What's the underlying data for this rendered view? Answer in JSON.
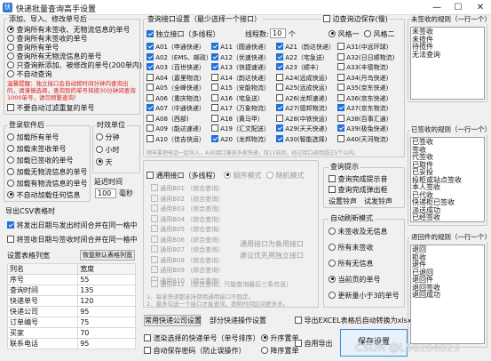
{
  "window": {
    "title": "快递批量查询高手设置",
    "minimize": "—",
    "maximize": "☐",
    "close": "✕"
  },
  "add_import": {
    "title": "添加、导入、修改单号后",
    "options": [
      {
        "label": "查询所有未签收、无物流信息的单号",
        "checked": true
      },
      {
        "label": "查询所有未签收的单号",
        "checked": false
      },
      {
        "label": "查询所有单号",
        "checked": false
      },
      {
        "label": "查询所有无物流信息的单号",
        "checked": false
      },
      {
        "label": "只查询新添加、被修改的单号(200单内)",
        "checked": false
      },
      {
        "label": "不自动查询",
        "checked": false
      }
    ],
    "warning": "温馨提醒：独立接口会自动按时间分钟内查询出的，请谨慎选择，查询到的单号将按30分钟间查询1000单号，请勿频繁查询！",
    "auto_filter": "不要自动过滤重复的单号"
  },
  "login": {
    "title": "登录软件后",
    "options": [
      {
        "label": "加载所有单号",
        "checked": false
      },
      {
        "label": "加载未签收单号",
        "checked": false
      },
      {
        "label": "加载已签收的单号",
        "checked": false
      },
      {
        "label": "加载无物流信息的单号",
        "checked": false
      },
      {
        "label": "加载有物流信息的单号",
        "checked": false
      },
      {
        "label": "不自动加载任何信息",
        "checked": true
      }
    ]
  },
  "time_unit": {
    "title": "时效单位",
    "options": [
      {
        "label": "分钟",
        "checked": false
      },
      {
        "label": "小时",
        "checked": false
      },
      {
        "label": "天",
        "checked": true
      }
    ]
  },
  "delay": {
    "title": "延迟时间",
    "value": "100",
    "unit": "毫秒"
  },
  "csv": {
    "title": "导出CSV表格时",
    "options": [
      {
        "label": "将发出日期与发出时间合并在同一格中",
        "checked": true
      },
      {
        "label": "将签收日期与签收时间合并在同一格中",
        "checked": false
      }
    ]
  },
  "columns": {
    "title": "设置表格列宽",
    "restore_button": "恢复默认表格列宽",
    "header": [
      "列名",
      "宽度"
    ],
    "rows": [
      {
        "name": "序号",
        "width": "55"
      },
      {
        "name": "查询时间",
        "width": "135"
      },
      {
        "name": "快递单号",
        "width": "120"
      },
      {
        "name": "快递公司",
        "width": "95"
      },
      {
        "name": "订单编号",
        "width": "75"
      },
      {
        "name": "买家",
        "width": "70"
      },
      {
        "name": "联系电话",
        "width": "95"
      }
    ]
  },
  "api": {
    "title": "查询接口设置（最少选择一个接口）",
    "edge_label": "边查询边保存(慢)",
    "standalone_label": "独立接口（多线程）",
    "thread_label": "线程数:",
    "thread_value": "10",
    "thread_unit": "个",
    "style1": "风格一",
    "style2": "风格二",
    "interfaces": [
      {
        "label": "A01（申通快递）",
        "checked": true
      },
      {
        "label": "A11（圆通快递）",
        "checked": true
      },
      {
        "label": "A21（韵达快递）",
        "checked": true
      },
      {
        "label": "A31(中远环球)",
        "checked": false
      },
      {
        "label": "A02（EMS、邮政）",
        "checked": true
      },
      {
        "label": "A12（优速快递）",
        "checked": true
      },
      {
        "label": "A22（宅急送）",
        "checked": true
      },
      {
        "label": "A32(日日顺物流)",
        "checked": false
      },
      {
        "label": "A03（百世快递）",
        "checked": true
      },
      {
        "label": "A13（快捷速递）",
        "checked": true
      },
      {
        "label": "A23（顺丰）",
        "checked": true
      },
      {
        "label": "A33(丰德物流)",
        "checked": false
      },
      {
        "label": "A04（嘉里物流）",
        "checked": false
      },
      {
        "label": "A14（韵达快递）",
        "checked": false
      },
      {
        "label": "A24(远成快运)",
        "checked": false
      },
      {
        "label": "A34(丹鸟快递)",
        "checked": false
      },
      {
        "label": "A05（全峰快递）",
        "checked": false
      },
      {
        "label": "A15（安能物流）",
        "checked": false
      },
      {
        "label": "A25(远成快运)",
        "checked": false
      },
      {
        "label": "A35(京东快递)",
        "checked": false
      },
      {
        "label": "A06（重庆物流）",
        "checked": false
      },
      {
        "label": "A16（宅急送）",
        "checked": false
      },
      {
        "label": "A26(龙邦速递)",
        "checked": false
      },
      {
        "label": "A36(京东快递)",
        "checked": false
      },
      {
        "label": "A07（中通快递）",
        "checked": true
      },
      {
        "label": "A17（万象物流）",
        "checked": false
      },
      {
        "label": "A27(德邦物流)",
        "checked": true
      },
      {
        "label": "A37(京东物流)",
        "checked": true
      },
      {
        "label": "A08（西部)",
        "checked": false
      },
      {
        "label": "A18（黄马甲）",
        "checked": false
      },
      {
        "label": "A28(中铁快运)",
        "checked": false
      },
      {
        "label": "A38(百事汇通)",
        "checked": false
      },
      {
        "label": "A09（能达速递）",
        "checked": false
      },
      {
        "label": "A19（汇文配送）",
        "checked": false
      },
      {
        "label": "A29(天天快递)",
        "checked": true
      },
      {
        "label": "A39(极兔快递)",
        "checked": true
      },
      {
        "label": "A10（佳吉快运）",
        "checked": false
      },
      {
        "label": "A20（龙邦物流）",
        "checked": true
      },
      {
        "label": "A30(智能选择)",
        "checked": true
      },
      {
        "label": "A40(天河物流)",
        "checked": false
      }
    ],
    "hint": "顺丰要把电话一起导入，A30接口兼容多家快递，双11前后，经过接口调用超过5个以内。",
    "common_label": "通用接口（多线程）",
    "seq_mode": "顺序模式",
    "rand_mode": "随机模式",
    "common_items": [
      "通用B01 （综合查询）",
      "通用B02 （综合查询）",
      "通用B03 （综合查询）",
      "通用B04 （综合查询）",
      "通用B05 （综合查询）",
      "通用B06 （综合查询）",
      "通用B07 （综合查询）",
      "通用B08 （综合查询）",
      "通用B09 （综合查询）",
      "通用B10 （综合查询）"
    ],
    "common_last": "通用B11 （综合查询，只能查询最后三条信息）",
    "common_note1": "通用接口为备用接口",
    "common_note2": "建议优先用独立接口",
    "footer_note1": "1、每家快递都支持使用通用接口不固定。",
    "footer_note2": "2、最多勾选一个接口才能查询，按照时间区间更多多。"
  },
  "query_hint": {
    "title": "查询提示",
    "options": [
      {
        "label": "查询完成提示音",
        "checked": false
      },
      {
        "label": "查询完成弹出框",
        "checked": false
      }
    ],
    "set_sound": "设置铃声",
    "test_sound": "试发铃声"
  },
  "auto_refresh": {
    "title": "自动刷新模式",
    "options": [
      {
        "label": "未签收及无信息",
        "checked": false
      },
      {
        "label": "所有未签收",
        "checked": false
      },
      {
        "label": "所有无信息",
        "checked": false
      },
      {
        "label": "当前页的单号",
        "checked": true
      },
      {
        "label": "更新量小于3的单号",
        "checked": false
      }
    ]
  },
  "bottom": {
    "common_settings_button": "常用快递公司设置",
    "partial_settings_button": "部分快递操作设置",
    "export_excel": "导出EXCEL表格后自动转换为xlsx格式",
    "color_label": "渲染选择的快递单号（单号排序）",
    "asc": "升序置单",
    "desc": "降序置单",
    "auto_save": "自动保存密码（防止误操作）",
    "auto_sync": "自用导出",
    "save_button": "保存设置",
    "watermark": "CSDN @L50204023"
  },
  "unsigned_rules": {
    "title": "未签收的规则（一行一个）",
    "lines": [
      "未签收",
      "未揽件",
      "待揽件",
      "无法查询"
    ]
  },
  "signed_rules": {
    "title": "已签收的规则（一行一个）",
    "lines": [
      "已签收",
      "签收",
      "代签收",
      "已取件",
      "已妥投",
      "投柜或站点签收",
      "本人签收",
      "已代收",
      "快递柜已签收",
      "派送成功",
      "已经签收",
      "门卫签收",
      "驿站代收",
      "家人代签",
      "已签收人",
      "本人已签"
    ]
  },
  "return_rules": {
    "title": "退回件的规则（一行一个）",
    "lines": [
      "退回",
      "拒收",
      "退件",
      "已退回",
      "退回件",
      "退回签收",
      "退回成功"
    ]
  }
}
